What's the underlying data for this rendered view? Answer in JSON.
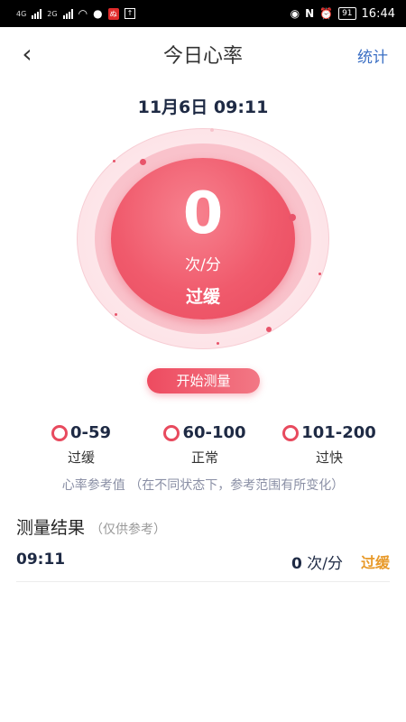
{
  "status_bar": {
    "net1": "4G",
    "net2": "2G",
    "battery": "91",
    "time": "16:44",
    "badge_red": "ぬ",
    "box": "↑"
  },
  "nav": {
    "back_icon": "chevron-left-icon",
    "title": "今日心率",
    "stats_label": "统计"
  },
  "datetime": "11月6日 09:11",
  "gauge": {
    "value": "0",
    "unit": "次/分",
    "status": "过缓"
  },
  "start_button": "开始测量",
  "ranges": [
    {
      "range": "0-59",
      "label": "过缓"
    },
    {
      "range": "60-100",
      "label": "正常"
    },
    {
      "range": "101-200",
      "label": "过快"
    }
  ],
  "reference_note": "心率参考值 （在不同状态下，参考范围有所变化）",
  "results": {
    "title": "测量结果",
    "subtitle": "（仅供参考）",
    "rows": [
      {
        "time": "09:11",
        "value": "0",
        "unit": "次/分",
        "status": "过缓"
      }
    ]
  },
  "colors": {
    "accent": "#e84a5e",
    "link": "#3b6fc4",
    "warning": "#e89a2a"
  }
}
